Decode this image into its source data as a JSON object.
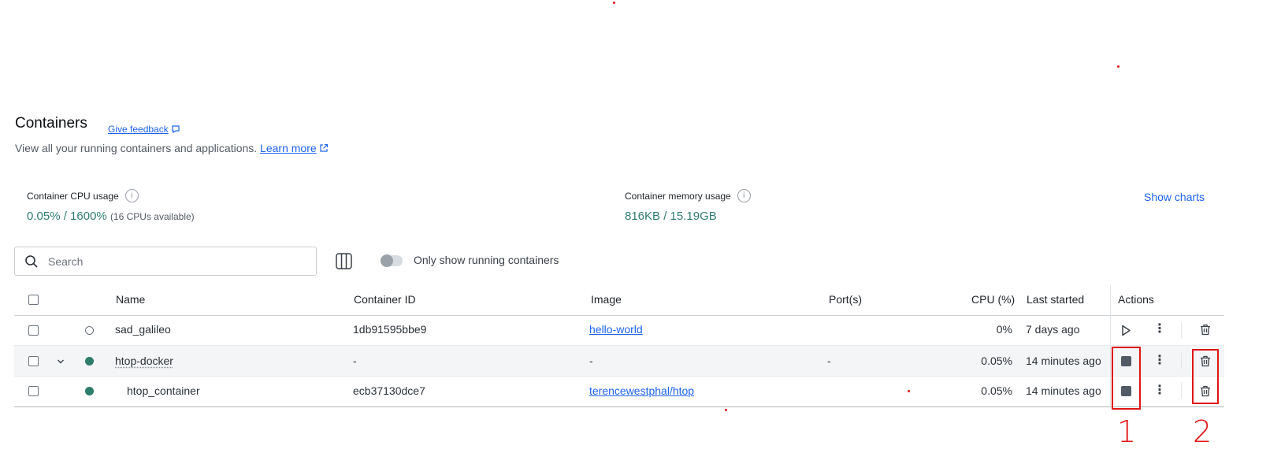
{
  "header": {
    "title": "Containers",
    "feedback": "Give feedback",
    "subtitle": "View all your running containers and applications.",
    "learn_more": "Learn more"
  },
  "stats": {
    "cpu_label": "Container CPU usage",
    "cpu_used": "0.05%",
    "cpu_total": "/ 1600%",
    "cpu_note": "(16 CPUs available)",
    "mem_label": "Container memory usage",
    "mem_used": "816KB",
    "mem_total": "/ 15.19GB",
    "show_charts": "Show charts"
  },
  "toolbar": {
    "search_placeholder": "Search",
    "running_only_label": "Only show running containers",
    "running_only": false
  },
  "table": {
    "columns": [
      "Name",
      "Container ID",
      "Image",
      "Port(s)",
      "CPU (%)",
      "Last started",
      "Actions"
    ],
    "rows": [
      {
        "name": "sad_galileo",
        "id": "1db91595bbe9",
        "image": "hello-world",
        "ports": "",
        "cpu": "0%",
        "last_started": "7 days ago",
        "status": "stopped"
      },
      {
        "name": "htop-docker",
        "id": "-",
        "image": "-",
        "ports": "-",
        "cpu": "0.05%",
        "last_started": "14 minutes ago",
        "status": "running"
      },
      {
        "name": "htop_container",
        "id": "ecb37130dce7",
        "image": "terencewestphal/htop",
        "ports": "",
        "cpu": "0.05%",
        "last_started": "14 minutes ago",
        "status": "running"
      }
    ]
  },
  "annotations": {
    "label_1": "1",
    "label_2": "2"
  },
  "colors": {
    "accent": "#1d63ed",
    "running": "#2e7d6a",
    "annotation": "#e01515"
  }
}
